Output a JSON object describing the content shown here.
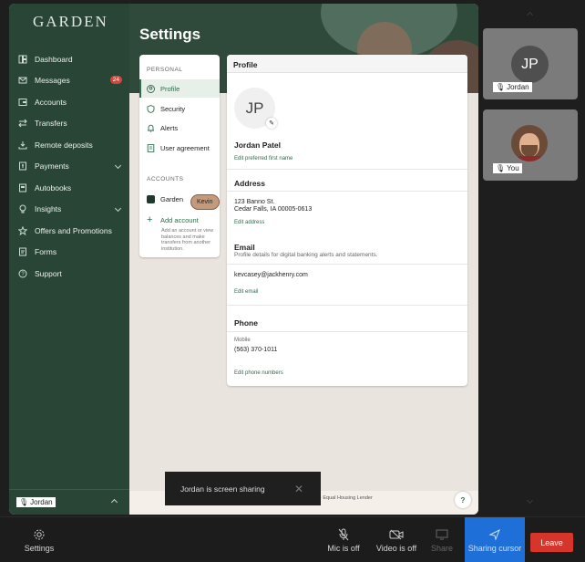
{
  "screen": {
    "logo": "GARDEN",
    "page_title": "Settings",
    "sidebar": {
      "items": [
        {
          "label": "Dashboard",
          "icon": "dashboard-icon"
        },
        {
          "label": "Messages",
          "icon": "mail-icon",
          "badge": "24"
        },
        {
          "label": "Accounts",
          "icon": "accounts-icon"
        },
        {
          "label": "Transfers",
          "icon": "transfer-icon"
        },
        {
          "label": "Remote deposits",
          "icon": "deposit-icon"
        },
        {
          "label": "Payments",
          "icon": "payments-icon"
        },
        {
          "label": "Autobooks",
          "icon": "autobooks-icon"
        },
        {
          "label": "Insights",
          "icon": "insights-icon"
        },
        {
          "label": "Offers and Promotions",
          "icon": "star-icon"
        },
        {
          "label": "Forms",
          "icon": "forms-icon"
        },
        {
          "label": "Support",
          "icon": "help-icon"
        }
      ],
      "presenter_tag": "Jordan"
    },
    "settings_nav": {
      "personal_label": "PERSONAL",
      "items": [
        "Profile",
        "Security",
        "Alerts",
        "User agreement"
      ],
      "accounts_label": "ACCOUNTS",
      "account_name": "Garden",
      "add_account": "Add account",
      "add_account_note": "Add an account or view balances and make transfers from another institution."
    },
    "profile": {
      "header": "Profile",
      "initials": "JP",
      "name": "Jordan Patel",
      "edit_name": "Edit preferred first name",
      "address_title": "Address",
      "address_line1": "123 Banno St.",
      "address_line2": "Cedar Falls, IA 00005-0613",
      "edit_address": "Edit address",
      "email_title": "Email",
      "email_desc": "Profile details for digital banking alerts and statements.",
      "email_value": "kevcasey@jackhenry.com",
      "edit_email": "Edit email",
      "phone_title": "Phone",
      "phone_label": "Mobile",
      "phone_value": "(563) 370-1011",
      "edit_phone": "Edit phone numbers"
    },
    "footer_text": "DIC · Equal Housing Lender",
    "help": "?",
    "cursor_tag": "Kevin"
  },
  "toast": {
    "text": "Jordan is screen sharing",
    "close": "✕"
  },
  "participants": [
    {
      "initials": "JP",
      "name": "Jordan"
    },
    {
      "name": "You"
    }
  ],
  "controls": {
    "settings": "Settings",
    "mic": "Mic is off",
    "video": "Video is off",
    "share": "Share",
    "sharing_cursor": "Sharing cursor",
    "leave": "Leave"
  },
  "colors": {
    "sidebar_bg": "#294536",
    "accent_green": "#2f6b4c",
    "sharing_blue": "#1f6fd8",
    "leave_red": "#d5352b",
    "badge_red": "#d8443a"
  }
}
